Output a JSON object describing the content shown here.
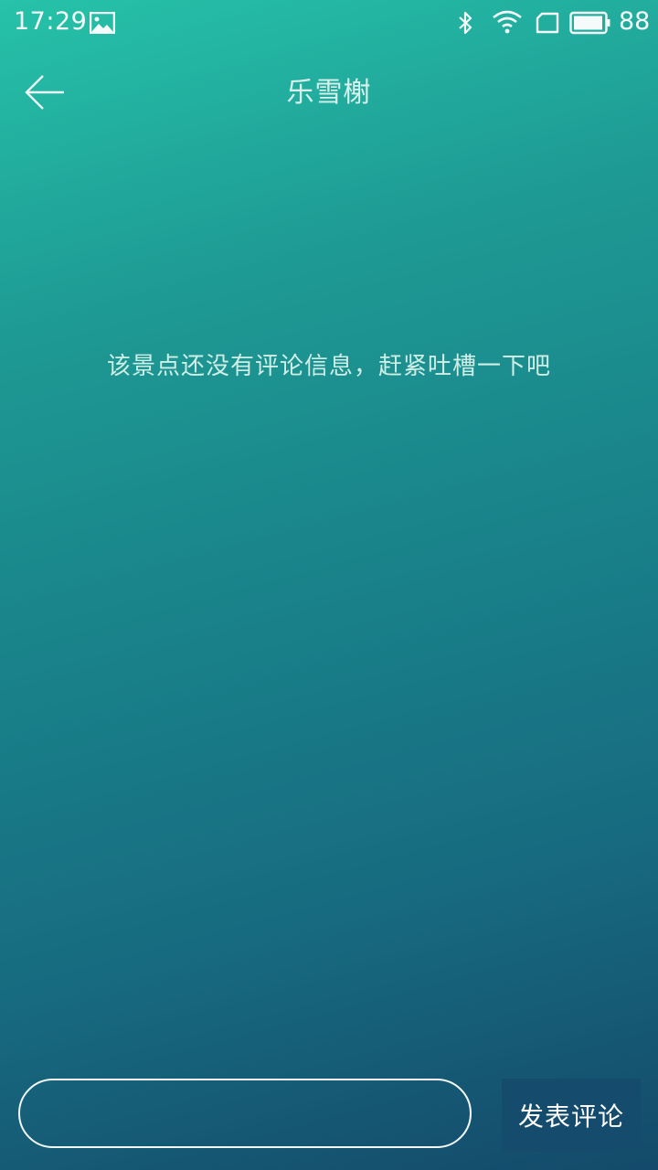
{
  "status_bar": {
    "time": "17:29",
    "battery_level": "88",
    "icons": [
      "image-icon",
      "bluetooth-icon",
      "wifi-icon",
      "sim-icon",
      "battery-icon"
    ]
  },
  "nav": {
    "back_icon": "arrow-left-icon",
    "title": "乐雪榭"
  },
  "main": {
    "empty_message": "该景点还没有评论信息，赶紧吐槽一下吧"
  },
  "comment_bar": {
    "input_value": "",
    "input_placeholder": "",
    "submit_label": "发表评论"
  },
  "colors": {
    "gradient_top": "#26c2a9",
    "gradient_bottom": "#144a6b",
    "submit_button_bg": "#154c6e"
  }
}
